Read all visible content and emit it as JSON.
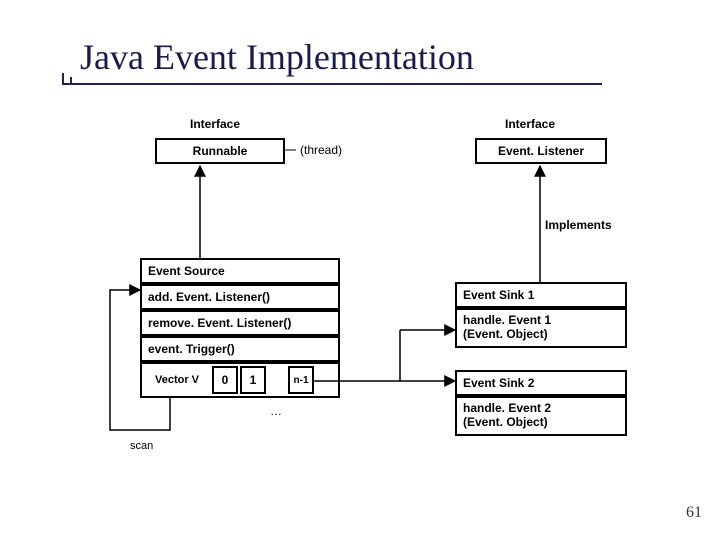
{
  "title": "Java Event Implementation",
  "labels": {
    "interface_left": "Interface",
    "interface_right": "Interface",
    "implements": "Implements",
    "ellipsis": "…",
    "scan": "scan"
  },
  "boxes": {
    "runnable": "Runnable",
    "event_listener": "Event. Listener",
    "event_source_header": "Event Source",
    "add_listener": "add. Event. Listener()",
    "remove_listener": "remove. Event. Listener()",
    "event_trigger": "event. Trigger()",
    "vector_label": "Vector V",
    "vec0": "0",
    "vec1": "1",
    "vecN": "n-1",
    "sink1": "Event Sink 1",
    "handle1_l1": "handle. Event 1",
    "handle1_l2": "(Event. Object)",
    "sink2": "Event Sink 2",
    "handle2_l1": "handle. Event 2",
    "handle2_l2": "(Event. Object)"
  },
  "thread_label": "(thread)",
  "page_number": "61"
}
